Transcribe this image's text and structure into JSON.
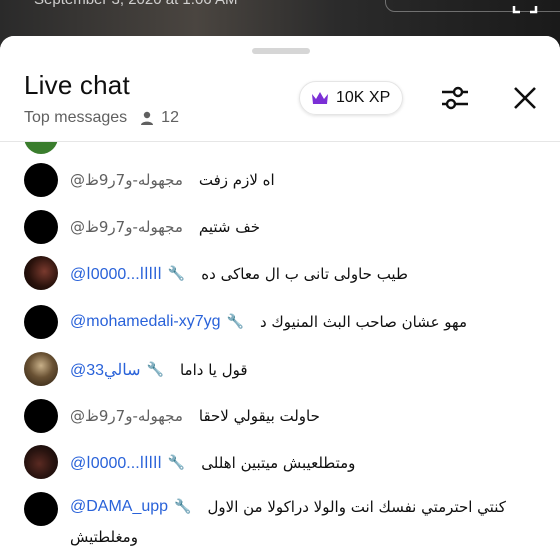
{
  "video": {
    "date_text": "September 3, 2020 at 1:06 AM"
  },
  "header": {
    "title": "Live chat",
    "mode_label": "Top messages",
    "viewer_count": "12",
    "xp_label": "10K XP"
  },
  "messages": [
    {
      "author": "@مجهوله-و7ر9ظ",
      "badge": "",
      "text": "اه لازم زفت"
    },
    {
      "author": "@مجهوله-و7ر9ظ",
      "badge": "",
      "text": "خف شتيم"
    },
    {
      "author": "@ﺍﺍﺍﺍﺍ...0000ﺍ",
      "badge": "🔧",
      "text": "طيب حاولى تانى ب ال معاكى ده"
    },
    {
      "author": "@mohamedali-xy7yg",
      "badge": "🔧",
      "text": "مهو عشان صاحب البث المنيوك د"
    },
    {
      "author": "@سالي33",
      "badge": "🔧",
      "text": "قول يا داما"
    },
    {
      "author": "@مجهوله-و7ر9ظ",
      "badge": "",
      "text": "حاولت بيقولي لاحقا"
    },
    {
      "author": "@ﺍﺍﺍﺍﺍ...0000ﺍ",
      "badge": "🔧",
      "text": "ومتطلعيبش ميتبين اهللى"
    },
    {
      "author": "@DAMA_upp",
      "badge": "🔧",
      "text": "كنتي احترمتي نفسك انت والولا دراكولا من الاول",
      "text_cont": "ومغلطتيش"
    }
  ],
  "colors": {
    "mod_blue": "#2962d9",
    "xp_crown": "#7b2fd6"
  }
}
